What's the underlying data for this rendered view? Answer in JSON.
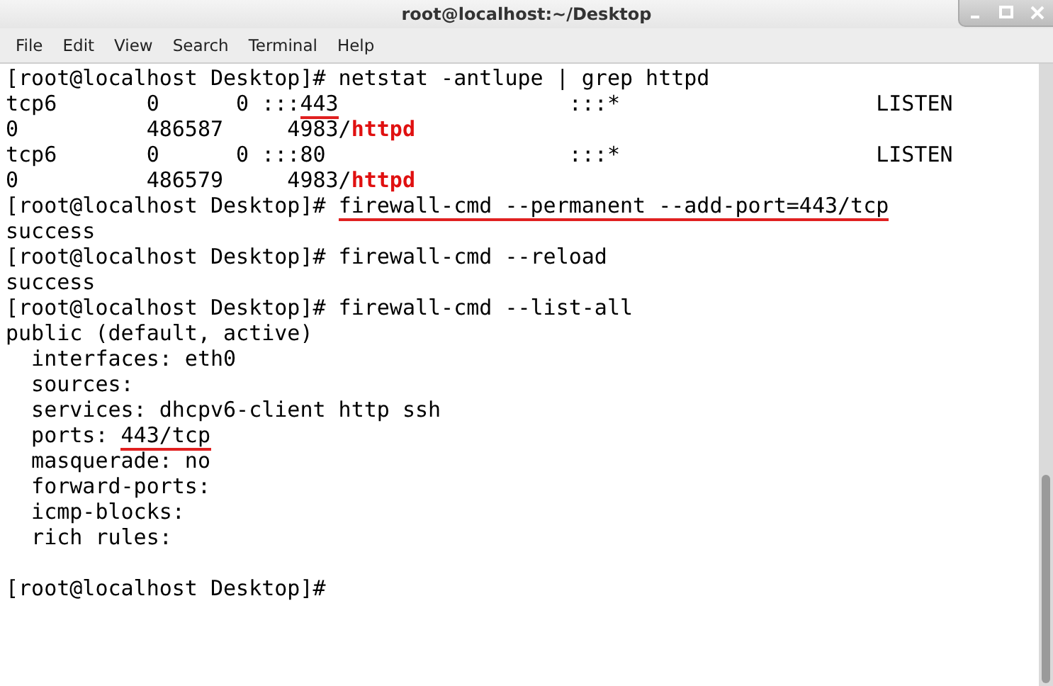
{
  "window": {
    "title": "root@localhost:~/Desktop"
  },
  "menu": [
    "File",
    "Edit",
    "View",
    "Search",
    "Terminal",
    "Help"
  ],
  "terminal": {
    "lines": [
      {
        "kind": "text",
        "segments": [
          {
            "text": "[root@localhost Desktop]# netstat -antlupe | grep httpd",
            "red": false,
            "underlined": false
          }
        ]
      },
      {
        "kind": "text",
        "segments": [
          {
            "text": "tcp6       0      0 :::",
            "red": false,
            "underlined": false
          },
          {
            "text": "443",
            "red": false,
            "underlined": true
          },
          {
            "text": "                  :::*                    LISTEN",
            "red": false,
            "underlined": false
          }
        ]
      },
      {
        "kind": "text",
        "segments": [
          {
            "text": "0          486587     4983/",
            "red": false,
            "underlined": false
          },
          {
            "text": "httpd",
            "red": true,
            "underlined": false
          }
        ]
      },
      {
        "kind": "text",
        "segments": [
          {
            "text": "tcp6       0      0 :::80                   :::*                    LISTEN",
            "red": false,
            "underlined": false
          }
        ]
      },
      {
        "kind": "text",
        "segments": [
          {
            "text": "0          486579     4983/",
            "red": false,
            "underlined": false
          },
          {
            "text": "httpd",
            "red": true,
            "underlined": false
          }
        ]
      },
      {
        "kind": "text",
        "segments": [
          {
            "text": "[root@localhost Desktop]# ",
            "red": false,
            "underlined": false
          },
          {
            "text": "firewall-cmd --permanent --add-port=443/tcp",
            "red": false,
            "underlined": true
          }
        ]
      },
      {
        "kind": "text",
        "segments": [
          {
            "text": "success",
            "red": false,
            "underlined": false
          }
        ]
      },
      {
        "kind": "text",
        "segments": [
          {
            "text": "[root@localhost Desktop]# firewall-cmd --reload",
            "red": false,
            "underlined": false
          }
        ]
      },
      {
        "kind": "text",
        "segments": [
          {
            "text": "success",
            "red": false,
            "underlined": false
          }
        ]
      },
      {
        "kind": "text",
        "segments": [
          {
            "text": "[root@localhost Desktop]# firewall-cmd --list-all",
            "red": false,
            "underlined": false
          }
        ]
      },
      {
        "kind": "text",
        "segments": [
          {
            "text": "public (default, active)",
            "red": false,
            "underlined": false
          }
        ]
      },
      {
        "kind": "text",
        "segments": [
          {
            "text": "  interfaces: eth0",
            "red": false,
            "underlined": false
          }
        ]
      },
      {
        "kind": "text",
        "segments": [
          {
            "text": "  sources:",
            "red": false,
            "underlined": false
          }
        ]
      },
      {
        "kind": "text",
        "segments": [
          {
            "text": "  services: dhcpv6-client http ssh",
            "red": false,
            "underlined": false
          }
        ]
      },
      {
        "kind": "text",
        "segments": [
          {
            "text": "  ports: ",
            "red": false,
            "underlined": false
          },
          {
            "text": "443/tcp",
            "red": false,
            "underlined": true
          }
        ]
      },
      {
        "kind": "text",
        "segments": [
          {
            "text": "  masquerade: no",
            "red": false,
            "underlined": false
          }
        ]
      },
      {
        "kind": "text",
        "segments": [
          {
            "text": "  forward-ports:",
            "red": false,
            "underlined": false
          }
        ]
      },
      {
        "kind": "text",
        "segments": [
          {
            "text": "  icmp-blocks:",
            "red": false,
            "underlined": false
          }
        ]
      },
      {
        "kind": "text",
        "segments": [
          {
            "text": "  rich rules:",
            "red": false,
            "underlined": false
          }
        ]
      },
      {
        "kind": "blank"
      },
      {
        "kind": "text",
        "segments": [
          {
            "text": "[root@localhost Desktop]#",
            "red": false,
            "underlined": false
          }
        ]
      }
    ]
  }
}
